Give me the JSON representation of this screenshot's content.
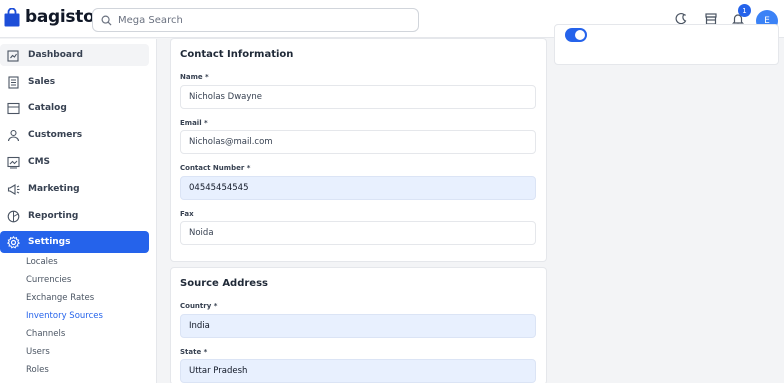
{
  "header": {
    "logo_text": "bagisto",
    "search_placeholder": "Mega Search",
    "notification_count": "1",
    "avatar_initial": "E"
  },
  "sidebar": {
    "items": [
      {
        "label": "Dashboard",
        "icon": "dashboard-icon"
      },
      {
        "label": "Sales",
        "icon": "sales-icon"
      },
      {
        "label": "Catalog",
        "icon": "catalog-icon"
      },
      {
        "label": "Customers",
        "icon": "customers-icon"
      },
      {
        "label": "CMS",
        "icon": "cms-icon"
      },
      {
        "label": "Marketing",
        "icon": "marketing-icon"
      },
      {
        "label": "Reporting",
        "icon": "reporting-icon"
      },
      {
        "label": "Settings",
        "icon": "settings-icon"
      }
    ],
    "settings_subitems": [
      "Locales",
      "Currencies",
      "Exchange Rates",
      "Inventory Sources",
      "Channels",
      "Users",
      "Roles"
    ]
  },
  "contact": {
    "title": "Contact Information",
    "name_label": "Name *",
    "name_value": "Nicholas Dwayne",
    "email_label": "Email *",
    "email_value": "Nicholas@mail.com",
    "contact_label": "Contact Number *",
    "contact_value": "04545454545",
    "fax_label": "Fax",
    "fax_value": "Noida"
  },
  "source_address": {
    "title": "Source Address",
    "country_label": "Country *",
    "country_value": "India",
    "state_label": "State *",
    "state_value": "Uttar Pradesh"
  },
  "colors": {
    "accent": "#2563eb",
    "filled_input": "#e8f0fe"
  }
}
